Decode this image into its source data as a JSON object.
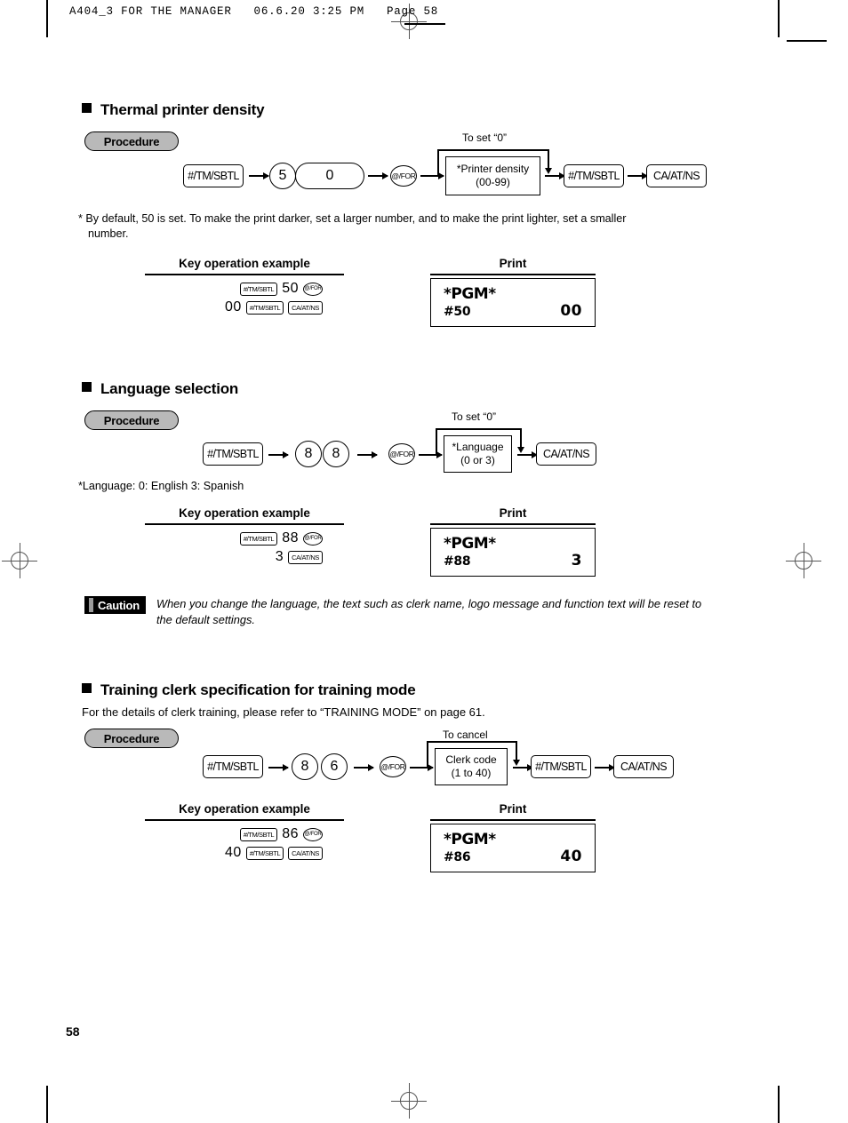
{
  "page": {
    "header": "A404_3 FOR THE MANAGER   06.6.20 3:25 PM   Page 58",
    "number": "58"
  },
  "labels": {
    "procedure": "Procedure",
    "key_operation_example": "Key operation example",
    "print": "Print"
  },
  "sections": [
    {
      "heading": "Thermal printer density",
      "flow": {
        "bypass_label": "To set “0”",
        "key1": "#/TM/SBTL",
        "digit1": "5",
        "digit2": "0",
        "atfor": "@/FOR",
        "box_line1": "*Printer density",
        "box_line2": "(00-99)",
        "key2": "#/TM/SBTL",
        "key3": "CA/AT/NS"
      },
      "footnote_line1": "* By default, 50 is set.  To make the print darker, set a larger number, and to make the print lighter, set a smaller",
      "footnote_line2": "number.",
      "example": {
        "row1_key": "#/TM/SBTL",
        "row1_num": "50",
        "row1_atfor": "@/FOR",
        "row2_num": "00",
        "row2_key1": "#/TM/SBTL",
        "row2_key2": "CA/AT/NS"
      },
      "print": {
        "title": "*PGM*",
        "code": "#50",
        "value": "00"
      }
    },
    {
      "heading": "Language selection",
      "flow": {
        "bypass_label": "To set “0”",
        "key1": "#/TM/SBTL",
        "digit1": "8",
        "digit2": "8",
        "atfor": "@/FOR",
        "box_line1": "*Language",
        "box_line2": "(0 or 3)",
        "key3": "CA/AT/NS"
      },
      "footnote_line1": "*Language: 0: English      3: Spanish",
      "example": {
        "row1_key": "#/TM/SBTL",
        "row1_num": "88",
        "row1_atfor": "@/FOR",
        "row2_num": "3",
        "row2_key2": "CA/AT/NS"
      },
      "print": {
        "title": "*PGM*",
        "code": "#88",
        "value": "3"
      },
      "caution": {
        "badge": "Caution",
        "text": "When you change the language, the text such as clerk name, logo message and function text will be reset to the default settings."
      }
    },
    {
      "heading": "Training clerk specification for training mode",
      "intro": "For the details of clerk training, please refer to “TRAINING MODE” on page 61.",
      "flow": {
        "bypass_label": "To cancel",
        "key1": "#/TM/SBTL",
        "digit1": "8",
        "digit2": "6",
        "atfor": "@/FOR",
        "box_line1": "Clerk code",
        "box_line2": "(1 to 40)",
        "key2": "#/TM/SBTL",
        "key3": "CA/AT/NS"
      },
      "example": {
        "row1_key": "#/TM/SBTL",
        "row1_num": "86",
        "row1_atfor": "@/FOR",
        "row2_num": "40",
        "row2_key1": "#/TM/SBTL",
        "row2_key2": "CA/AT/NS"
      },
      "print": {
        "title": "*PGM*",
        "code": "#86",
        "value": "40"
      }
    }
  ]
}
